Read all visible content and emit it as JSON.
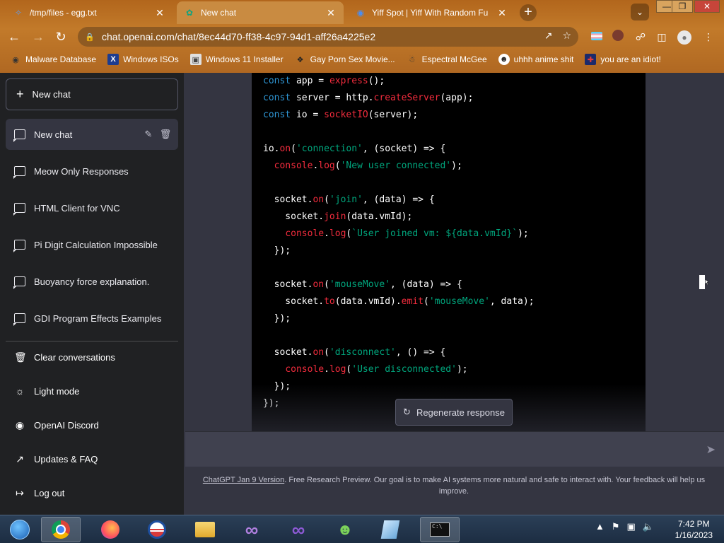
{
  "browser": {
    "tabs": [
      {
        "title": "/tmp/files - egg.txt",
        "icon": "folder-icon"
      },
      {
        "title": "New chat",
        "icon": "openai-icon"
      },
      {
        "title": "Yiff Spot | Yiff With Random Fu",
        "icon": "site-icon"
      }
    ],
    "url": "chat.openai.com/chat/8ec44d70-ff38-4c97-94d1-aff26a4225e2",
    "bookmarks": [
      "Malware Database",
      "Windows ISOs",
      "Windows 11 Installer",
      "Gay Porn Sex Movie...",
      "Espectral McGee",
      "uhhh anime shit",
      "you are an idiot!"
    ]
  },
  "sidebar": {
    "new_chat": "New chat",
    "conversations": [
      "New chat",
      "Meow Only Responses",
      "HTML Client for VNC",
      "Pi Digit Calculation Impossible",
      "Buoyancy force explanation.",
      "GDI Program Effects Examples"
    ],
    "menu": [
      "Clear conversations",
      "Light mode",
      "OpenAI Discord",
      "Updates & FAQ",
      "Log out"
    ]
  },
  "main": {
    "regenerate": "Regenerate response",
    "footer_link": "ChatGPT Jan 9 Version",
    "footer_text": ". Free Research Preview. Our goal is to make AI systems more natural and safe to interact with. Your feedback will help us improve."
  },
  "taskbar": {
    "time": "7:42 PM",
    "date": "1/16/2023"
  },
  "colors": {
    "sidebar_bg": "#202123",
    "main_bg": "#343541",
    "code_bg": "#000000",
    "keyword": "#2e95d3",
    "function": "#f22c3d",
    "string": "#00a67d"
  }
}
